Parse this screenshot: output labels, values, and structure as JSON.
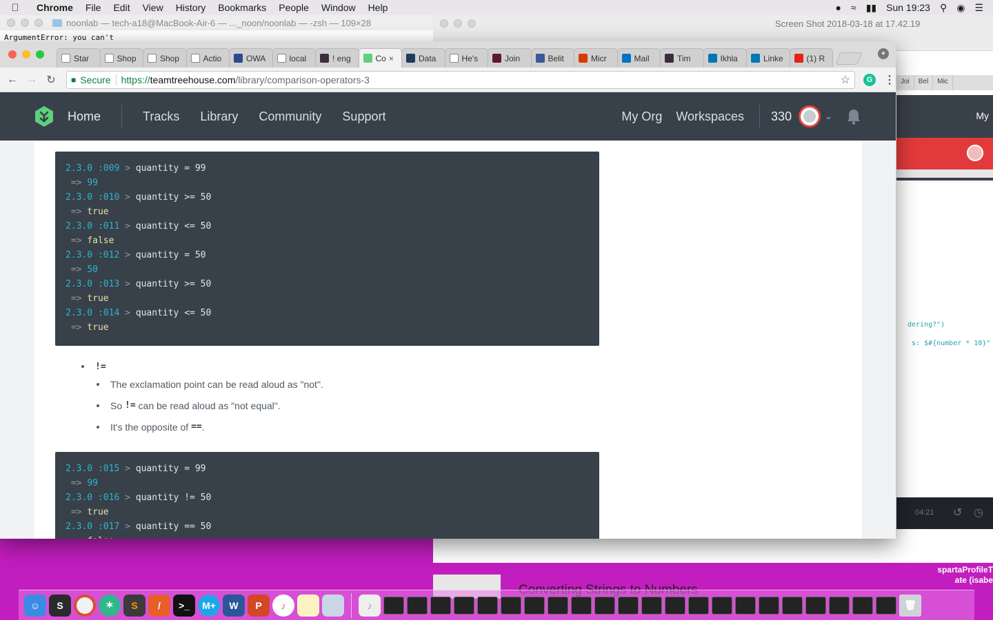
{
  "menubar": {
    "items": [
      "Chrome",
      "File",
      "Edit",
      "View",
      "History",
      "Bookmarks",
      "People",
      "Window",
      "Help"
    ],
    "clock": "Sun 19:23"
  },
  "terminal": {
    "title": "noonlab — tech-a18@MacBook-Air-6 — ..._noon/noonlab — -zsh — 109×28",
    "text": "ArgumentError: you can't"
  },
  "preview": {
    "title": "Screen Shot 2018-03-18 at 17.42.19",
    "tabs": [
      "Joi",
      "Bel",
      "Mic"
    ],
    "nav_label": "My",
    "code_1": "dering?\")",
    "code_2": "s: $#{number * 10}\"",
    "video_time": "04:21",
    "caption": "Converting Strings to Numbers"
  },
  "tabs": [
    {
      "label": "Star",
      "icon": "page-icon",
      "color": "#ffffff"
    },
    {
      "label": "Shop",
      "icon": "page-icon",
      "color": "#ffffff"
    },
    {
      "label": "Shop",
      "icon": "page-icon",
      "color": "#ffffff"
    },
    {
      "label": "Actio",
      "icon": "page-icon",
      "color": "#ffffff"
    },
    {
      "label": "OWA",
      "icon": "globe-icon",
      "color": "#2c4a8a"
    },
    {
      "label": "local",
      "icon": "page-icon",
      "color": "#ffffff"
    },
    {
      "label": "! eng",
      "icon": "slack-icon",
      "color": "#3e2c3e"
    },
    {
      "label": "Co",
      "icon": "treehouse-icon",
      "color": "#5fcf80",
      "active": true
    },
    {
      "label": "Data",
      "icon": "p-icon",
      "color": "#1e3b5a"
    },
    {
      "label": "He's",
      "icon": "amazon-icon",
      "color": "#ffffff"
    },
    {
      "label": "Join",
      "icon": "meetup-icon",
      "color": "#5b1a2a"
    },
    {
      "label": "Belit",
      "icon": "facebook-icon",
      "color": "#3b5998"
    },
    {
      "label": "Micr",
      "icon": "office-icon",
      "color": "#d83b01"
    },
    {
      "label": "Mail",
      "icon": "outlook-icon",
      "color": "#0072c6"
    },
    {
      "label": "Tim",
      "icon": "slack-icon",
      "color": "#3e2c3e"
    },
    {
      "label": "Ikhla",
      "icon": "linkedin-icon",
      "color": "#0077b5"
    },
    {
      "label": "Linke",
      "icon": "linkedin-icon",
      "color": "#0077b5"
    },
    {
      "label": "(1) R",
      "icon": "youtube-icon",
      "color": "#e62117"
    }
  ],
  "address": {
    "secure_label": "Secure",
    "scheme": "https://",
    "host": "teamtreehouse.com",
    "path": "/library/comparison-operators-3"
  },
  "sitenav": {
    "home": "Home",
    "links": [
      "Tracks",
      "Library",
      "Community",
      "Support"
    ],
    "right_links": [
      "My Org",
      "Workspaces"
    ],
    "points": "330"
  },
  "code_block_1": [
    {
      "prompt": "2.3.0 :009",
      "code": "quantity = 99",
      "result": "99",
      "result_type": "num"
    },
    {
      "prompt": "2.3.0 :010",
      "code": "quantity >= 50",
      "result": "true",
      "result_type": "kw"
    },
    {
      "prompt": "2.3.0 :011",
      "code": "quantity <= 50",
      "result": "false",
      "result_type": "kw"
    },
    {
      "prompt": "2.3.0 :012",
      "code": "quantity = 50",
      "result": "50",
      "result_type": "num"
    },
    {
      "prompt": "2.3.0 :013",
      "code": "quantity >= 50",
      "result": "true",
      "result_type": "kw"
    },
    {
      "prompt": "2.3.0 :014",
      "code": "quantity <= 50",
      "result": "true",
      "result_type": "kw"
    }
  ],
  "bullets": {
    "operator": "!=",
    "sub": [
      {
        "pre": "The exclamation point can be read aloud as \"not\".",
        "code": "",
        "post": ""
      },
      {
        "pre": "So ",
        "code": "!=",
        "post": " can be read aloud as \"not equal\"."
      },
      {
        "pre": "It's the opposite of ",
        "code": "==",
        "post": "."
      }
    ]
  },
  "code_block_2": [
    {
      "prompt": "2.3.0 :015",
      "code": "quantity = 99",
      "result": "99",
      "result_type": "num"
    },
    {
      "prompt": "2.3.0 :016",
      "code": "quantity != 50",
      "result": "true",
      "result_type": "kw"
    },
    {
      "prompt": "2.3.0 :017",
      "code": "quantity == 50",
      "result": "false",
      "result_type": "kw"
    }
  ],
  "desktop": {
    "file_line1": "spartaProfileT",
    "file_line2": "ate (isabe"
  },
  "colors": {
    "desktop": "#c21dbe",
    "nav": "#384049",
    "code_bg": "#384049",
    "accent_green": "#5fcf80",
    "avatar_ring": "#e04646"
  }
}
